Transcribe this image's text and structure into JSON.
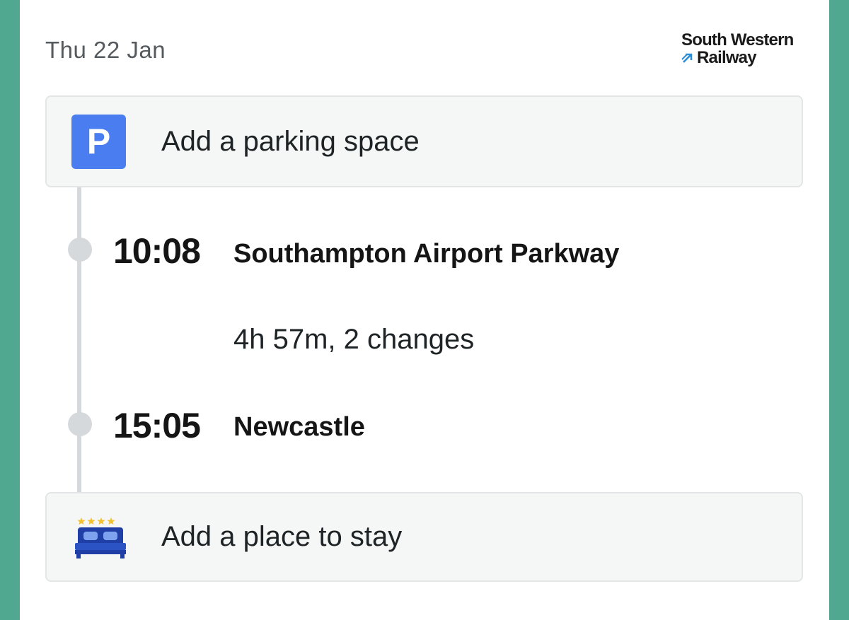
{
  "header": {
    "date": "Thu 22 Jan",
    "logo_line1": "South Western",
    "logo_line2": "Railway"
  },
  "parking_card": {
    "icon_letter": "P",
    "label": "Add a parking space"
  },
  "journey": {
    "departure": {
      "time": "10:08",
      "station": "Southampton Airport Parkway"
    },
    "summary": "4h 57m, 2 changes",
    "arrival": {
      "time": "15:05",
      "station": "Newcastle"
    }
  },
  "stay_card": {
    "label": "Add a place to stay",
    "icon": "hotel-bed-icon",
    "stars": 4
  },
  "colors": {
    "background": "#4fa88f",
    "parking_blue": "#4a7ef0",
    "bed_navy": "#1f3fa6",
    "star_yellow": "#f2c230"
  }
}
